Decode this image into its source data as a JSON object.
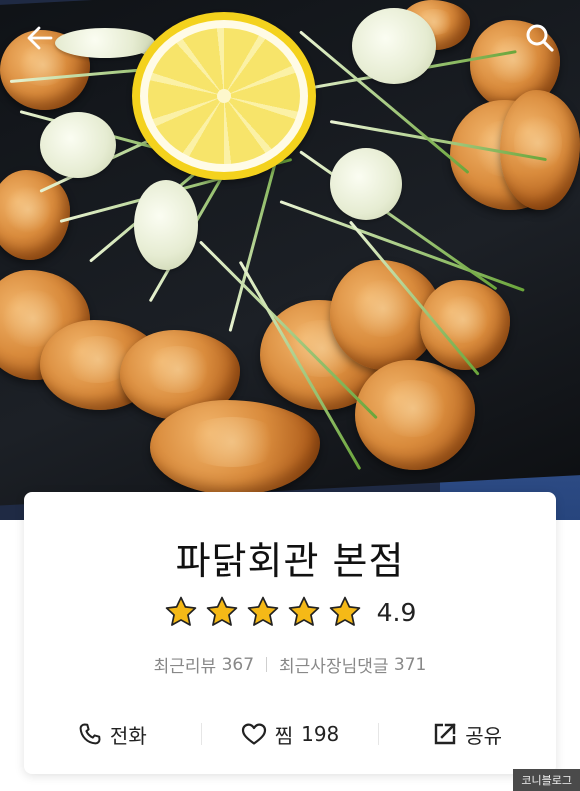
{
  "header": {
    "back_icon": "arrow-left-icon",
    "search_icon": "search-icon"
  },
  "restaurant": {
    "name": "파닭회관 본점",
    "rating": "4.9",
    "stars": 5,
    "star_color": "#f5b917"
  },
  "stats": {
    "recent_reviews_label": "최근리뷰",
    "recent_reviews_count": "367",
    "owner_replies_label": "최근사장님댓글",
    "owner_replies_count": "371"
  },
  "actions": {
    "call_label": "전화",
    "call_icon": "phone-icon",
    "like_label": "찜",
    "like_count": "198",
    "like_icon": "heart-icon",
    "share_label": "공유",
    "share_icon": "share-icon"
  },
  "watermark": "코니블로그"
}
